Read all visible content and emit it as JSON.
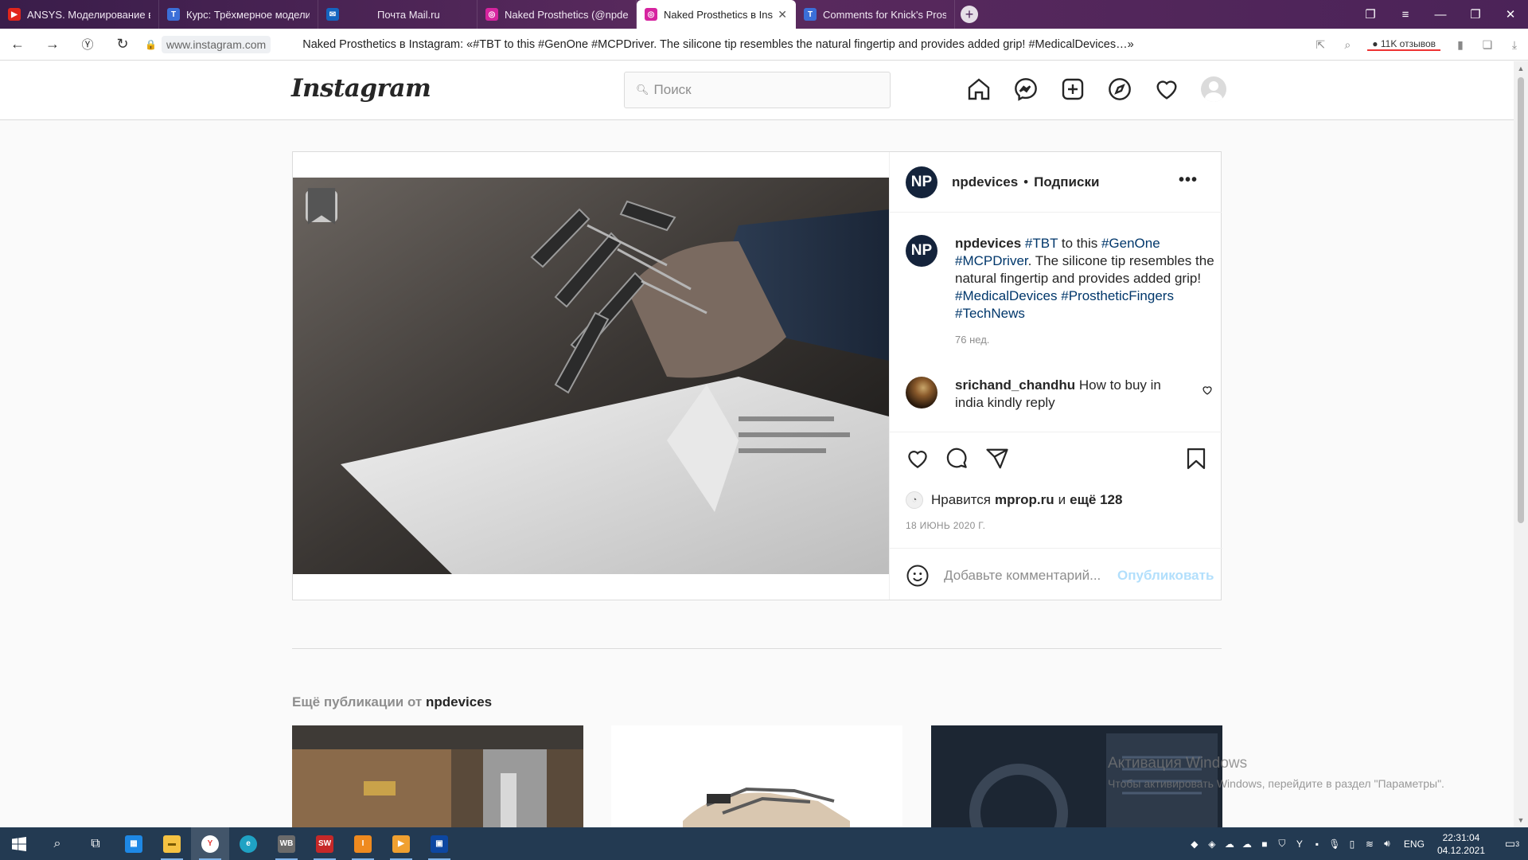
{
  "browser": {
    "tabs": [
      {
        "title": "ANSYS. Моделирование в",
        "favicon_color": "#e1261c",
        "favicon": "youtube-icon",
        "active": false
      },
      {
        "title": "Курс: Трёхмерное модели",
        "favicon_color": "#3b6fd8",
        "favicon": "course-icon",
        "active": false
      },
      {
        "title": "Почта Mail.ru",
        "favicon_color": "#1565c0",
        "favicon": "mail-icon",
        "active": false
      },
      {
        "title": "Naked Prosthetics (@npde",
        "favicon_color": "#d6249f",
        "favicon": "instagram-icon",
        "active": false
      },
      {
        "title": "Naked Prosthetics в Inst",
        "favicon_color": "#d6249f",
        "favicon": "instagram-icon",
        "active": true
      },
      {
        "title": "Comments for Knick's Pros",
        "favicon_color": "#3b6fd8",
        "favicon": "course-icon",
        "active": false
      }
    ],
    "address": {
      "host": "www.instagram.com",
      "page_title": "Naked Prosthetics в Instagram: «#TBT to this #GenOne #MCPDriver. The silicone tip resembles the natural fingertip and provides added grip! #MedicalDevices…»",
      "reviews": "11K отзывов"
    }
  },
  "instagram": {
    "logo": "Instagram",
    "search_placeholder": "Поиск",
    "post": {
      "avatar_initials": "NP",
      "username": "npdevices",
      "follow_state": "Подписки",
      "caption_user": "npdevices",
      "caption_parts": [
        "#TBT",
        " to this ",
        "#GenOne",
        " ",
        "#MCPDriver",
        ". The silicone tip resembles the natural fingertip and provides added grip! ",
        "#MedicalDevices",
        " ",
        "#ProstheticFingers",
        " ",
        "#TechNews"
      ],
      "age": "76 нед.",
      "comment_user": "srichand_chandhu",
      "comment_text": "How to buy in india kindly reply",
      "likes_prefix": "Нравится",
      "likes_user": "mprop.ru",
      "likes_mid": "и",
      "likes_rest": "ещё 128",
      "date": "18 ИЮНЬ 2020 Г.",
      "comment_placeholder": "Добавьте комментарий...",
      "publish_label": "Опубликовать",
      "publish_color": "#b2dffc"
    },
    "more_posts": {
      "title_prefix": "Ещё публикации от",
      "title_user": "npdevices"
    }
  },
  "watermark": {
    "line1": "Активация Windows",
    "line2": "Чтобы активировать Windows, перейдите в раздел \"Параметры\"."
  },
  "taskbar": {
    "lang": "ENG",
    "time": "22:31:04",
    "date": "04.12.2021",
    "notifications": "3"
  }
}
